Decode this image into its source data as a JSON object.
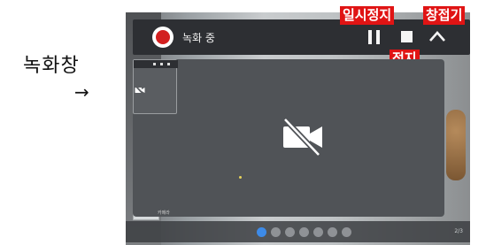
{
  "caption": {
    "label": "녹화창",
    "arrow": "→"
  },
  "recording_bar": {
    "status_text": "녹화 중",
    "record_indicator_icon": "record-dot-icon",
    "pause_icon": "pause-icon",
    "stop_icon": "stop-icon",
    "collapse_icon": "chevron-up-icon"
  },
  "annotations": {
    "pause": "일시정지",
    "stop": "정지",
    "collapse": "창접기"
  },
  "video": {
    "camera_off_icon": "video-off-icon",
    "caption": "카메라"
  },
  "dock": {
    "left_text": "",
    "right_text": "2/3"
  },
  "colors": {
    "annotation_red": "#e01414",
    "record_red": "#d21f1f",
    "bar_bg": "#2d2f33",
    "panel_bg": "#505357",
    "dock_active": "#3d8be8"
  }
}
